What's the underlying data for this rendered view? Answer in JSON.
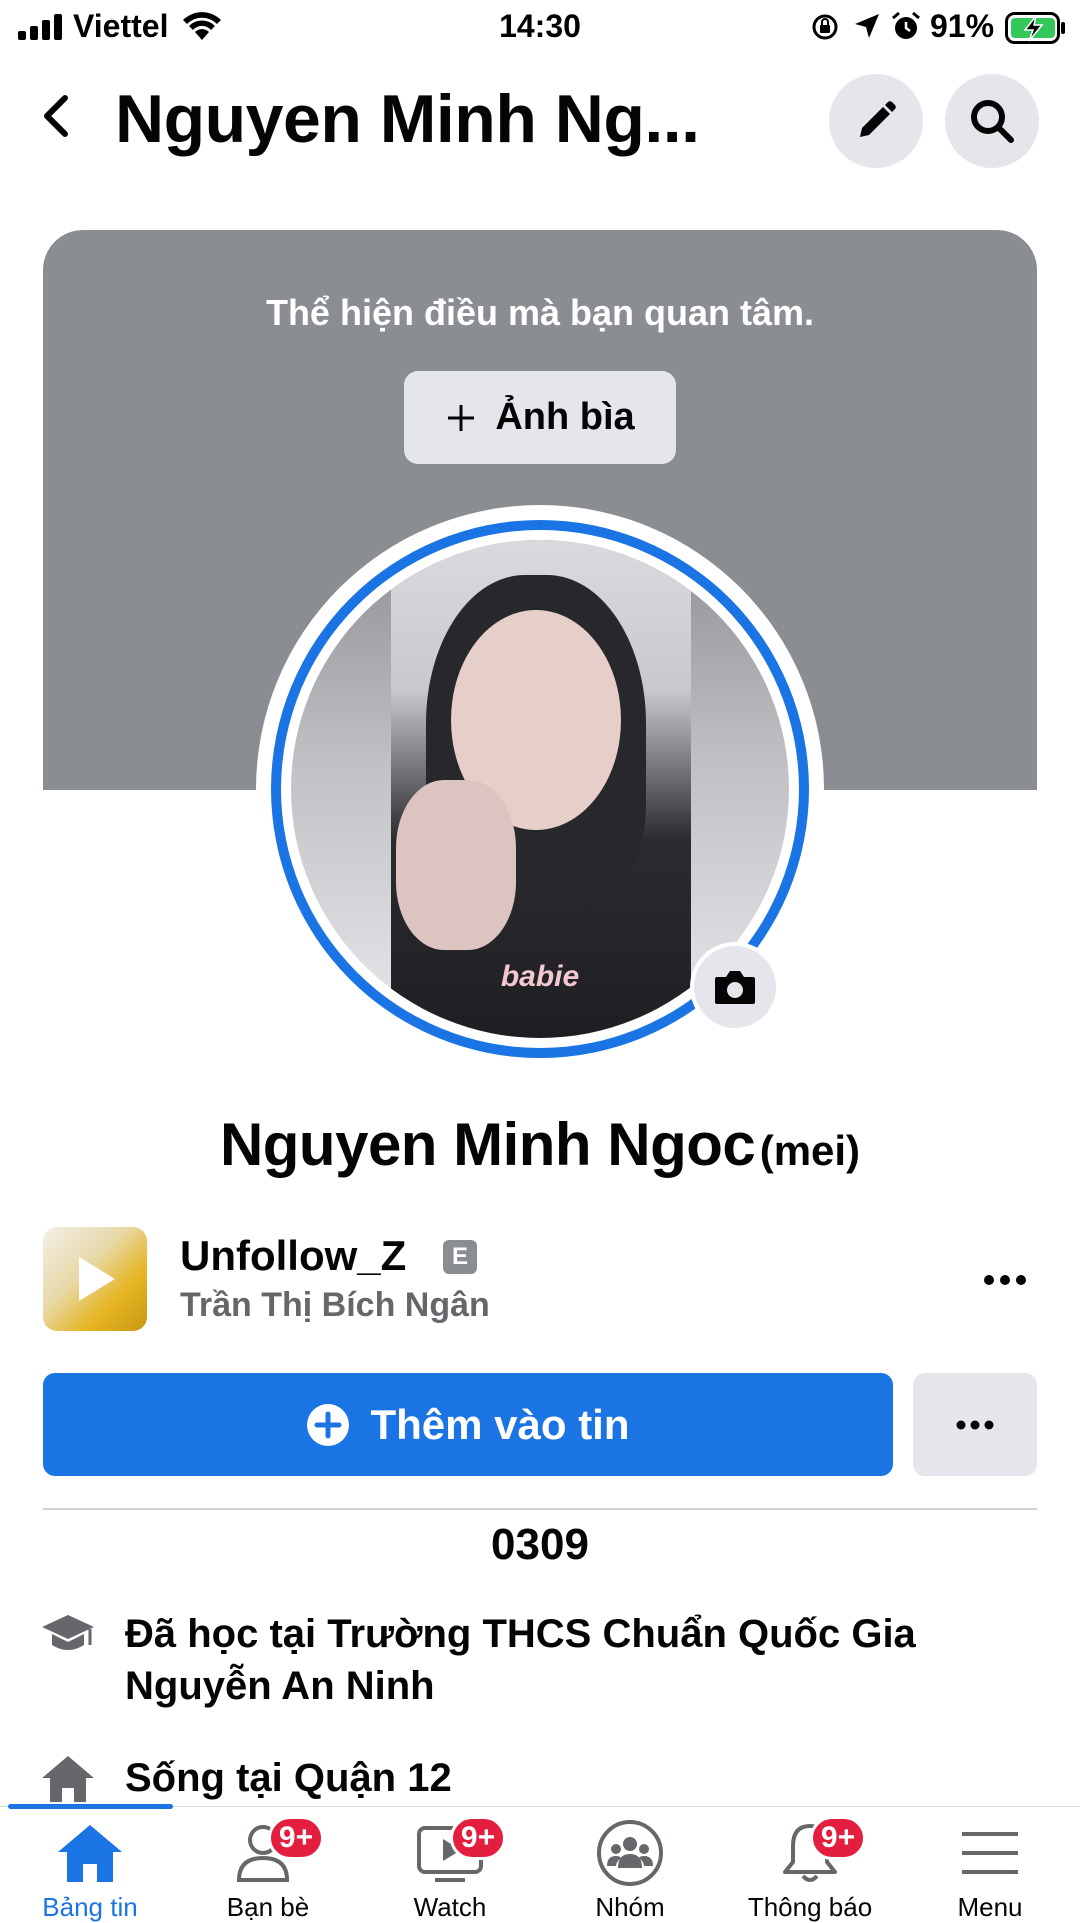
{
  "status_bar": {
    "carrier": "Viettel",
    "time": "14:30",
    "battery": "91%",
    "icons": [
      "signal-icon",
      "wifi-icon",
      "orientation-lock-icon",
      "location-icon",
      "alarm-icon",
      "battery-charging-icon"
    ]
  },
  "header": {
    "title": "Nguyen Minh Ng...",
    "icons": [
      "back-icon",
      "edit-icon",
      "search-icon"
    ]
  },
  "cover": {
    "prompt": "Thể hiện điều mà bạn quan tâm.",
    "button_label": "Ảnh bìa",
    "color": "#8a8d91"
  },
  "avatar": {
    "overlay_text": "babie",
    "ring_color": "#1b74e4"
  },
  "profile": {
    "name": "Nguyen Minh Ngoc",
    "alt_name": "(mei)",
    "bio": "0309"
  },
  "music": {
    "title": "Unfollow_Z",
    "explicit": "E",
    "artist": "Trần Thị Bích Ngân"
  },
  "actions": {
    "add_story_label": "Thêm vào tin",
    "accent": "#1b74e4"
  },
  "details": [
    {
      "icon": "education-icon",
      "text": "Đã học tại Trường THCS Chuẩn Quốc Gia Nguyễn An Ninh"
    },
    {
      "icon": "home-icon",
      "text": "Sống tại Quận 12"
    }
  ],
  "nav": [
    {
      "label": "Bảng tin",
      "badge": "",
      "active": true
    },
    {
      "label": "Bạn bè",
      "badge": "9+",
      "active": false
    },
    {
      "label": "Watch",
      "badge": "9+",
      "active": false
    },
    {
      "label": "Nhóm",
      "badge": "",
      "active": false
    },
    {
      "label": "Thông báo",
      "badge": "9+",
      "active": false
    },
    {
      "label": "Menu",
      "badge": "",
      "active": false
    }
  ],
  "badge_color": "#e41e3f"
}
